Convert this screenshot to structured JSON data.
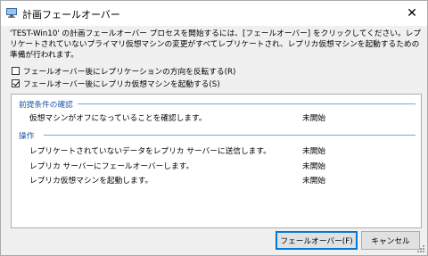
{
  "window": {
    "title": "計画フェールオーバー"
  },
  "description": "'TEST-Win10' の計画フェールオーバー プロセスを開始するには、[フェールオーバー] をクリックしてください。レプリケートされていないプライマリ仮想マシンの変更がすべてレプリケートされ、レプリカ仮想マシンを起動するための準備が行われます。",
  "options": [
    {
      "label": "フェールオーバー後にレプリケーションの方向を反転する(R)",
      "checked": false
    },
    {
      "label": "フェールオーバー後にレプリカ仮想マシンを起動する(S)",
      "checked": true
    }
  ],
  "sections": {
    "prerequisites": {
      "title": "前提条件の確認",
      "items": [
        {
          "label": "仮想マシンがオフになっていることを確認します。",
          "status": "未開始"
        }
      ]
    },
    "actions": {
      "title": "操作",
      "items": [
        {
          "label": "レプリケートされていないデータをレプリカ サーバーに送信します。",
          "status": "未開始"
        },
        {
          "label": "レプリカ サーバーにフェールオーバーします。",
          "status": "未開始"
        },
        {
          "label": "レプリカ仮想マシンを起動します。",
          "status": "未開始"
        }
      ]
    }
  },
  "buttons": {
    "failover": "フェールオーバー(F)",
    "cancel": "キャンセル"
  },
  "icons": {
    "app": "hyperv-vm-icon",
    "close": "close-icon"
  },
  "colors": {
    "section_title": "#1c57a6",
    "section_line": "#7aa7d8",
    "primary_border": "#0078d7"
  }
}
